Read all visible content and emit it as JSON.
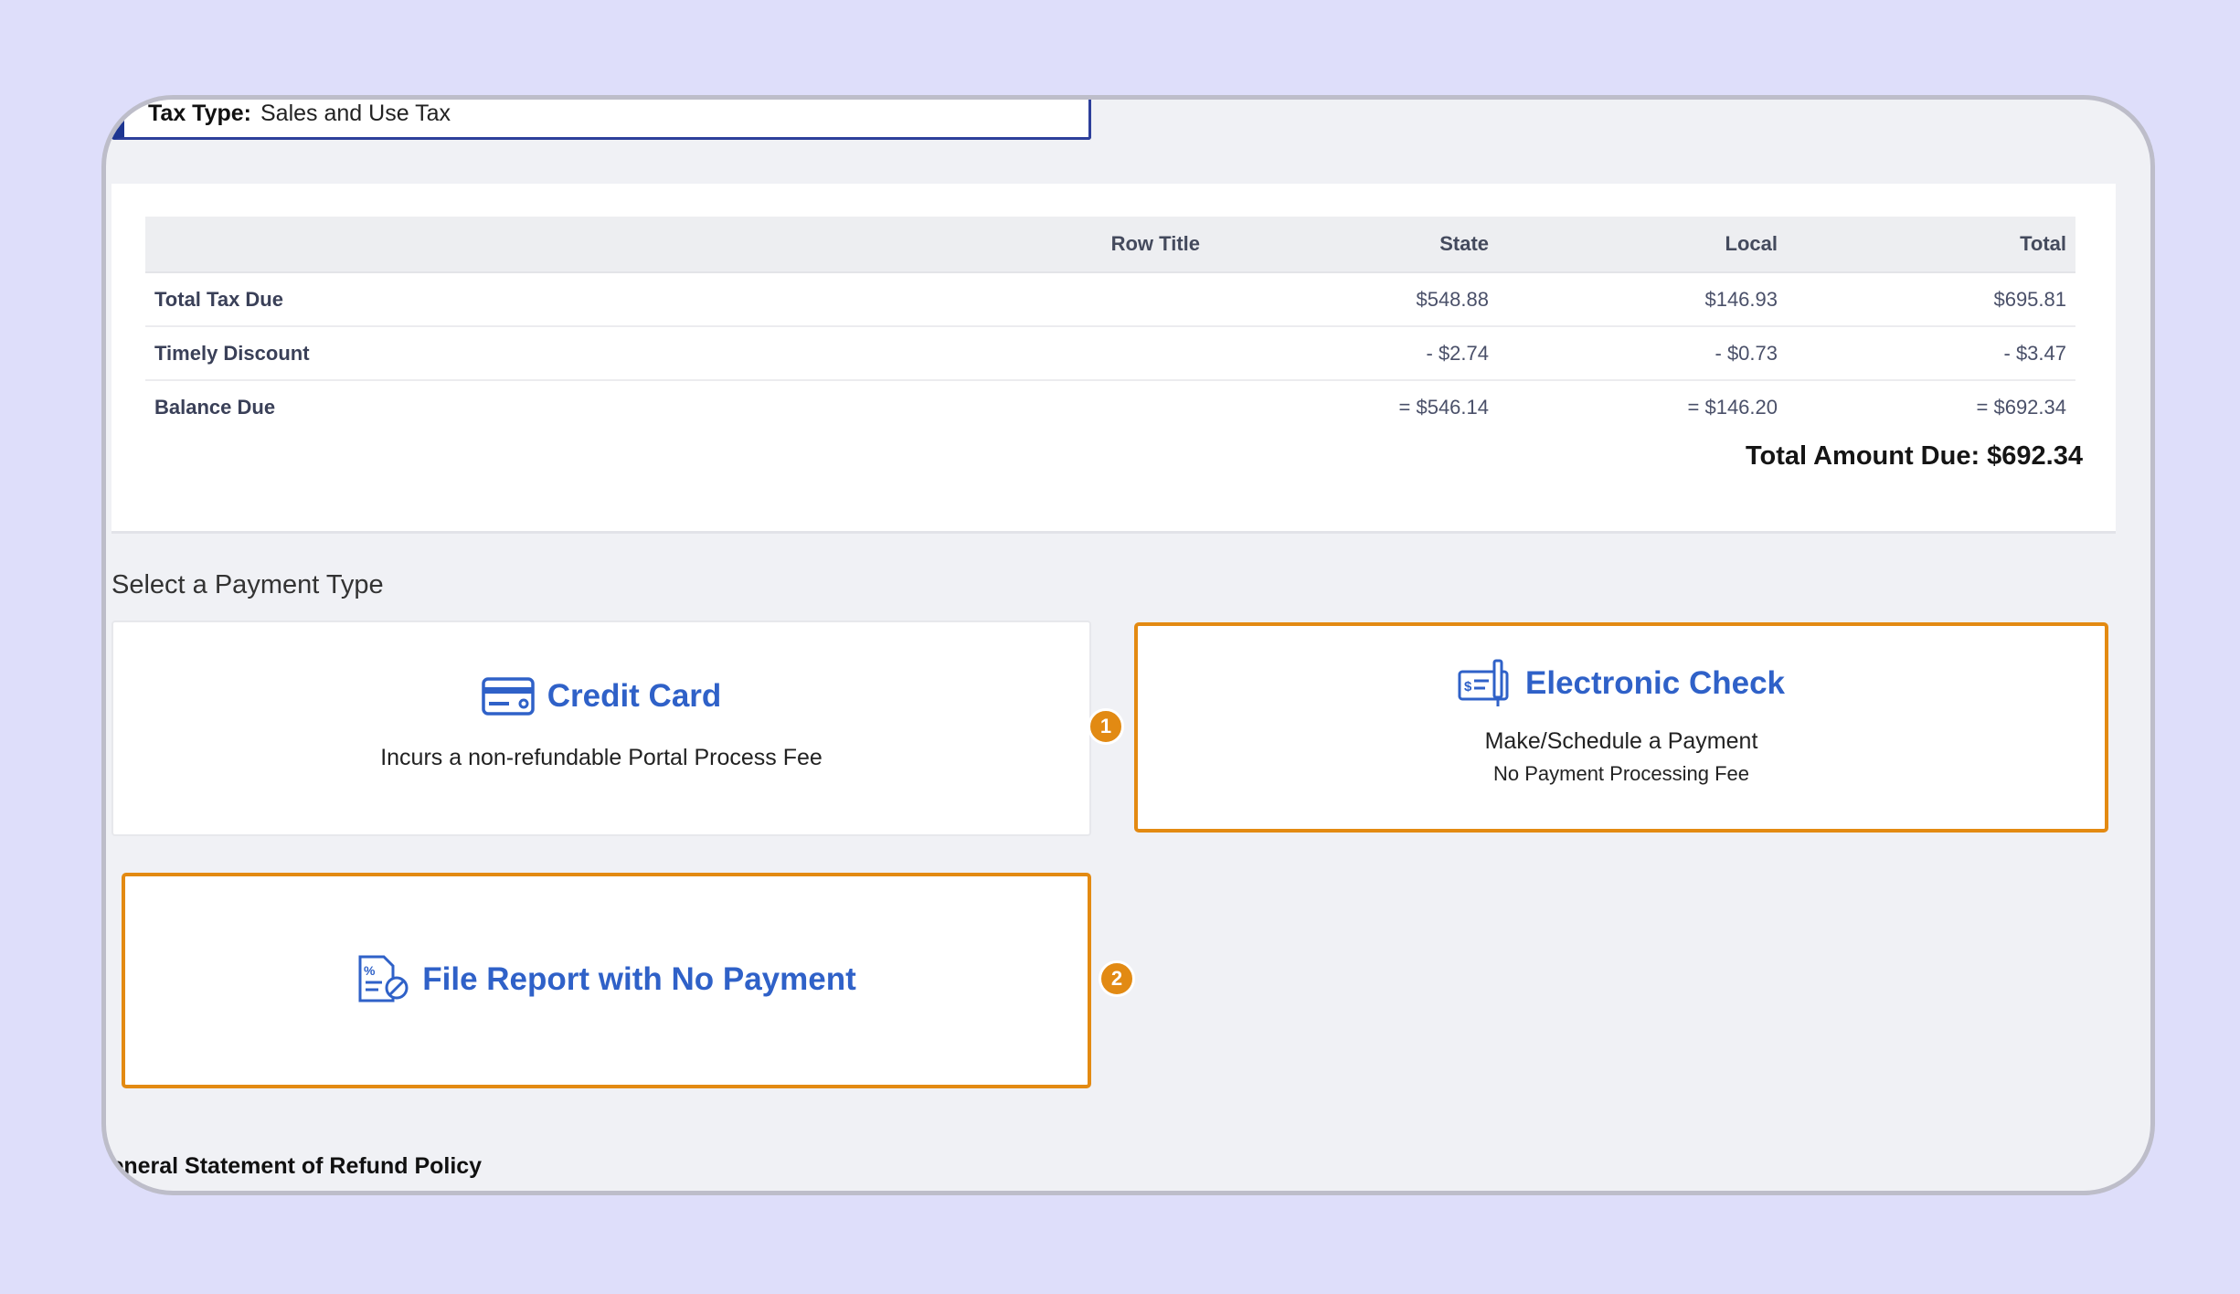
{
  "tax_type": {
    "label": "Tax Type:",
    "value": "Sales and Use Tax"
  },
  "table": {
    "headers": [
      "",
      "Row Title",
      "State",
      "Local",
      "Total"
    ],
    "rows": [
      {
        "label": "Total Tax Due",
        "state": "$548.88",
        "local": "$146.93",
        "total": "$695.81"
      },
      {
        "label": "Timely Discount",
        "state": "- $2.74",
        "local": "- $0.73",
        "total": "- $3.47"
      },
      {
        "label": "Balance Due",
        "state": "= $546.14",
        "local": "= $146.20",
        "total": "= $692.34"
      }
    ],
    "total_amount_due": "Total Amount Due: $692.34"
  },
  "payment_section": {
    "title": "Select a Payment Type",
    "credit_card": {
      "title": "Credit Card",
      "subtitle": "Incurs a non-refundable Portal Process Fee",
      "icon": "credit-card-icon"
    },
    "electronic_check": {
      "title": "Electronic Check",
      "subtitle": "Make/Schedule a Payment",
      "note": "No Payment Processing Fee",
      "icon": "check-icon"
    },
    "no_payment": {
      "title": "File Report with No Payment",
      "icon": "file-report-icon"
    }
  },
  "badges": {
    "one": "1",
    "two": "2"
  },
  "refund_heading": "General Statement of Refund Policy",
  "colors": {
    "accent": "#2f61c8",
    "highlight": "#e38a12",
    "navy": "#1d3590",
    "background": "#dedefa"
  }
}
